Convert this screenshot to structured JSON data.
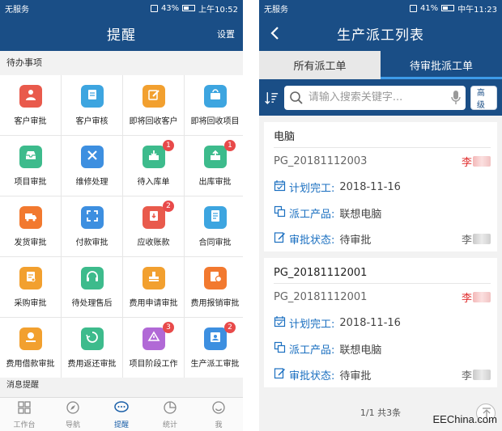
{
  "left": {
    "status": {
      "carrier": "无服务",
      "battery": "43%",
      "time": "上午10:52"
    },
    "header": {
      "title": "提醒",
      "action": "设置"
    },
    "todo_title": "待办事项",
    "grid": [
      {
        "label": "客户审批",
        "color": "#e95a4c",
        "icon": "user-approve-icon",
        "badge": ""
      },
      {
        "label": "客户审核",
        "color": "#3da5e0",
        "icon": "user-review-icon",
        "badge": ""
      },
      {
        "label": "即将回收客户",
        "color": "#f2a02f",
        "icon": "edit-icon",
        "badge": ""
      },
      {
        "label": "即将回收项目",
        "color": "#3da5e0",
        "icon": "recycle-box-icon",
        "badge": ""
      },
      {
        "label": "项目审批",
        "color": "#3dbb8c",
        "icon": "inbox-icon",
        "badge": ""
      },
      {
        "label": "维修处理",
        "color": "#3d8fe0",
        "icon": "wrench-icon",
        "badge": ""
      },
      {
        "label": "待入库单",
        "color": "#3dbb8c",
        "icon": "download-box-icon",
        "badge": "1"
      },
      {
        "label": "出库审批",
        "color": "#3dbb8c",
        "icon": "upload-box-icon",
        "badge": "1"
      },
      {
        "label": "发货审批",
        "color": "#f2792f",
        "icon": "truck-icon",
        "badge": ""
      },
      {
        "label": "付款审批",
        "color": "#3d8fe0",
        "icon": "expand-icon",
        "badge": ""
      },
      {
        "label": "应收账款",
        "color": "#e95a4c",
        "icon": "receivable-icon",
        "badge": "2"
      },
      {
        "label": "合同审批",
        "color": "#3da5e0",
        "icon": "contract-icon",
        "badge": ""
      },
      {
        "label": "采购审批",
        "color": "#f2a02f",
        "icon": "purchase-icon",
        "badge": ""
      },
      {
        "label": "待处理售后",
        "color": "#3dbb8c",
        "icon": "headset-icon",
        "badge": ""
      },
      {
        "label": "费用申请审批",
        "color": "#f2a02f",
        "icon": "stamp-icon",
        "badge": ""
      },
      {
        "label": "费用报销审批",
        "color": "#f2792f",
        "icon": "reimburse-icon",
        "badge": ""
      },
      {
        "label": "费用借款审批",
        "color": "#f2a02f",
        "icon": "loan-icon",
        "badge": ""
      },
      {
        "label": "费用返还审批",
        "color": "#3dbb8c",
        "icon": "refund-icon",
        "badge": ""
      },
      {
        "label": "项目阶段工作",
        "color": "#b169d6",
        "icon": "stage-recycle-icon",
        "badge": "3"
      },
      {
        "label": "生产派工审批",
        "color": "#3d8fe0",
        "icon": "dispatch-icon",
        "badge": "2"
      }
    ],
    "msg_title": "消息提醒",
    "tabs": [
      {
        "label": "工作台",
        "icon": "grid-icon",
        "active": false
      },
      {
        "label": "导航",
        "icon": "navigation-icon",
        "active": false
      },
      {
        "label": "提醒",
        "icon": "chat-bubble-icon",
        "active": true
      },
      {
        "label": "统计",
        "icon": "pie-chart-icon",
        "active": false
      },
      {
        "label": "我",
        "icon": "smile-icon",
        "active": false
      }
    ]
  },
  "right": {
    "status": {
      "carrier": "无服务",
      "battery": "41%",
      "time": "中午11:23"
    },
    "header": {
      "title": "生产派工列表"
    },
    "segments": [
      {
        "label": "所有派工单",
        "active": false
      },
      {
        "label": "待审批派工单",
        "active": true
      }
    ],
    "search": {
      "placeholder": "请输入搜索关键字...",
      "advanced": "高级"
    },
    "cards": [
      {
        "title": "电脑",
        "code": "PG_20181112003",
        "owner": "李",
        "plan_label": "计划完工:",
        "plan_value": "2018-11-16",
        "product_label": "派工产品:",
        "product_value": "联想电脑",
        "status_label": "审批状态:",
        "status_value": "待审批",
        "approver": "李"
      },
      {
        "title": "PG_20181112001",
        "code": "PG_20181112001",
        "owner": "李",
        "plan_label": "计划完工:",
        "plan_value": "2018-11-16",
        "product_label": "派工产品:",
        "product_value": "联想电脑",
        "status_label": "审批状态:",
        "status_value": "待审批",
        "approver": "李"
      }
    ],
    "pager": "1/1 共3条"
  },
  "watermark": "EEChina.com"
}
